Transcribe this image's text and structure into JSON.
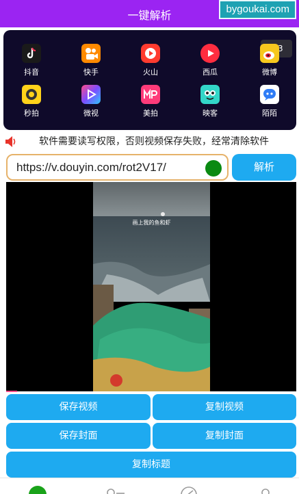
{
  "header": {
    "title": "一键解析"
  },
  "watermark": "bygoukai.com",
  "apps": {
    "page_indicator": "1/3",
    "items": [
      {
        "label": "抖音",
        "icon": "douyin-icon",
        "color": "#1a1a1a"
      },
      {
        "label": "快手",
        "icon": "kuaishou-icon",
        "color": "#ff8a00"
      },
      {
        "label": "火山",
        "icon": "huoshan-icon",
        "color": "#ff3b2f"
      },
      {
        "label": "西瓜",
        "icon": "xigua-icon",
        "color": "#ff2d40"
      },
      {
        "label": "微博",
        "icon": "weibo-icon",
        "color": "#f7c81e"
      },
      {
        "label": "秒拍",
        "icon": "miaopai-icon",
        "color": "#ffd21a"
      },
      {
        "label": "微视",
        "icon": "weishi-icon",
        "color": "#7b4dff"
      },
      {
        "label": "美拍",
        "icon": "meipai-icon",
        "color": "#ff3b7a"
      },
      {
        "label": "映客",
        "icon": "yingke-icon",
        "color": "#33d6c8"
      },
      {
        "label": "陌陌",
        "icon": "momo-icon",
        "color": "#2f7cf6"
      }
    ]
  },
  "notice": {
    "text": "软件需要读写权限，否则视频保存失败，经常清除软件"
  },
  "input": {
    "url": "https://v.douyin.com/rot2V17/"
  },
  "buttons": {
    "parse": "解析",
    "save_video": "保存视频",
    "copy_video": "复制视频",
    "save_cover": "保存封面",
    "copy_cover": "复制封面",
    "copy_title": "复制标题"
  },
  "video": {
    "caption": "画上我的鱼和虾"
  },
  "colors": {
    "header": "#9b24f2",
    "accent": "#1eaaf0",
    "panel": "#0f0a2a",
    "input_border": "#e6b26a"
  }
}
